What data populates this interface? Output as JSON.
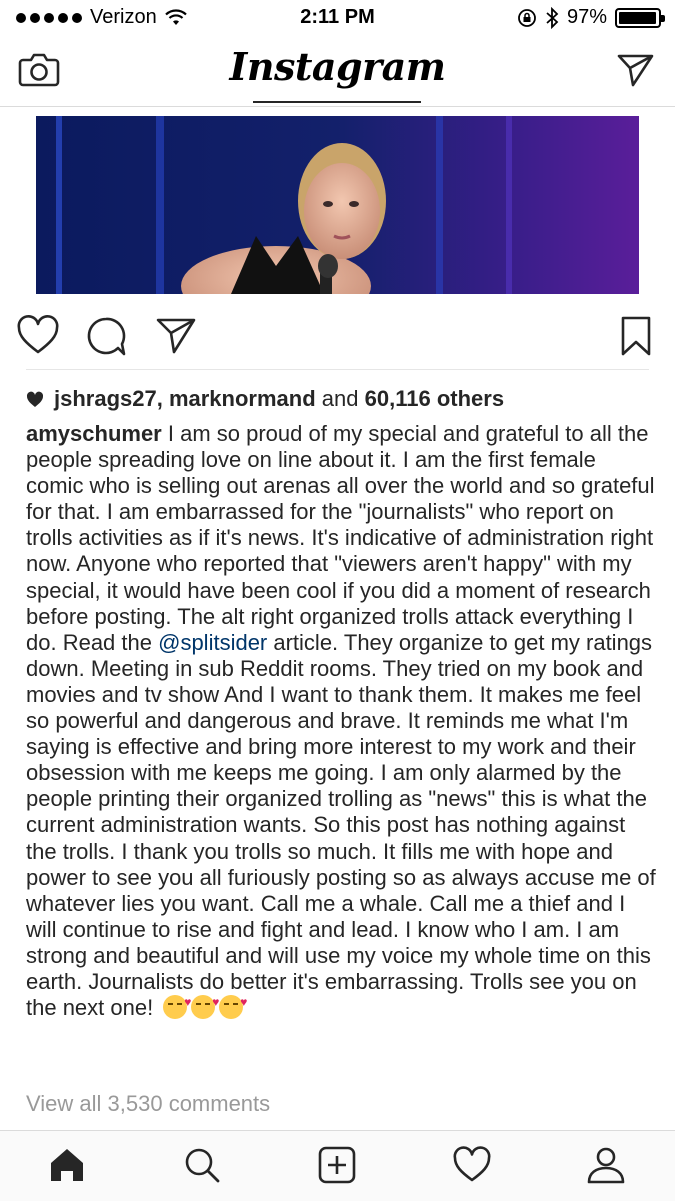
{
  "status_bar": {
    "carrier": "Verizon",
    "time": "2:11 PM",
    "battery": "97%",
    "battery_level": 0.97
  },
  "header": {
    "logo": "Instagram"
  },
  "post": {
    "likes": {
      "users": "jshrags27, marknormand",
      "conjunction": "and",
      "others": "60,116 others"
    },
    "caption": {
      "username": "amyschumer",
      "text_before_mention": "I am so proud of my special and grateful to all the people spreading love on line about it. I am the first female comic who is selling out arenas all over the world and so grateful for that. I am embarrassed for the \"journalists\" who report on trolls activities as if it's news. It's indicative of administration right now. Anyone who reported that \"viewers aren't happy\" with my special, it would have been cool if you did a moment of research before posting. The alt right organized trolls attack everything I do. Read the",
      "mention": "@splitsider",
      "text_after_mention": "article. They organize to get my ratings down. Meeting in sub Reddit rooms. They tried on my book and movies and tv show And I want to thank them. It makes me feel so powerful and dangerous and brave. It reminds me what I'm saying is effective and bring more interest to my work and their obsession with me keeps me going. I am only alarmed by the people printing their organized trolling as \"news\" this is what the current administration wants. So this post has nothing against the trolls. I thank you trolls so much. It fills me with hope and power to see you all furiously posting so as always accuse me of whatever lies you want. Call me a whale. Call me a thief and I will continue to rise and fight and lead. I know who I am. I am strong and beautiful and will use my voice my whole time on this earth. Journalists do better it's embarrassing. Trolls see you on the next one!",
      "emojis": [
        "face-blowing-kiss",
        "face-blowing-kiss",
        "face-blowing-kiss"
      ]
    },
    "view_comments": "View all 3,530 comments"
  },
  "colors": {
    "text": "#262626",
    "mention": "#003569",
    "muted": "#999999",
    "divider": "#dbdbdb"
  },
  "icons": {
    "header": [
      "camera-icon",
      "direct-message-icon"
    ],
    "actions": [
      "heart-icon",
      "comment-icon",
      "share-icon",
      "bookmark-icon"
    ],
    "tabs": [
      "home-icon",
      "search-icon",
      "add-post-icon",
      "activity-heart-icon",
      "profile-icon"
    ]
  }
}
